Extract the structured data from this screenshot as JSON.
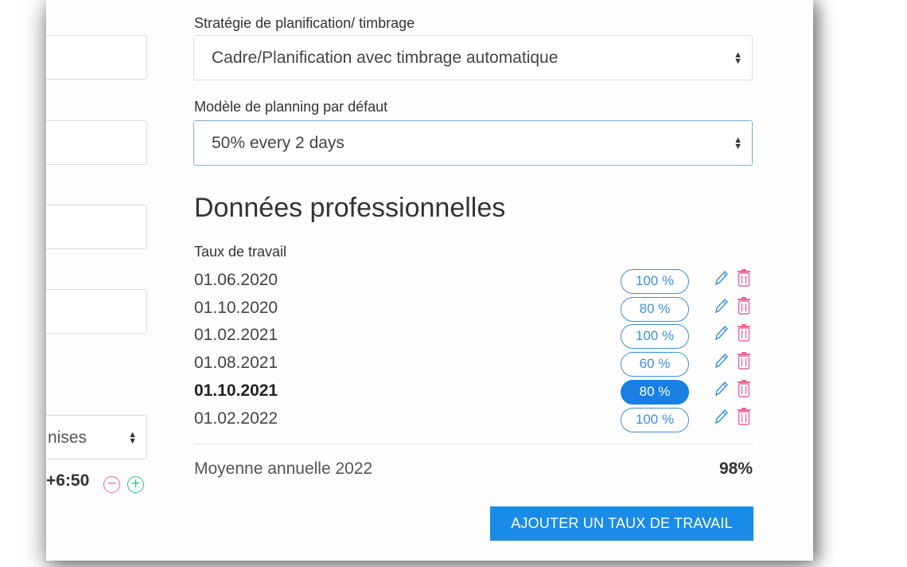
{
  "left_column": {
    "select_partial_value": "nises",
    "time_adjust": "+6:50"
  },
  "planning_strategy": {
    "label": "Stratégie de planification/ timbrage",
    "value": "Cadre/Planification avec timbrage automatique"
  },
  "default_planning_model": {
    "label": "Modèle de planning par défaut",
    "value": "50% every 2 days"
  },
  "professional_data": {
    "title": "Données professionnelles",
    "work_rate_label": "Taux de travail",
    "rates": [
      {
        "date": "01.06.2020",
        "rate": "100 %",
        "active": false
      },
      {
        "date": "01.10.2020",
        "rate": "80 %",
        "active": false
      },
      {
        "date": "01.02.2021",
        "rate": "100 %",
        "active": false
      },
      {
        "date": "01.08.2021",
        "rate": "60 %",
        "active": false
      },
      {
        "date": "01.10.2021",
        "rate": "80 %",
        "active": true
      },
      {
        "date": "01.02.2022",
        "rate": "100 %",
        "active": false
      }
    ],
    "annual_average_label": "Moyenne annuelle 2022",
    "annual_average_value": "98%",
    "add_button_label": "AJOUTER UN TAUX DE TRAVAIL"
  },
  "colors": {
    "accent": "#1a8ce8",
    "pill_border": "#3a8fe0",
    "delete": "#e8669a",
    "add": "#2fbf8a"
  },
  "icons": {
    "edit": "pencil-icon",
    "delete": "trash-icon",
    "minus": "minus-circle-icon",
    "plus": "plus-circle-icon",
    "select_arrows": "updown-arrows-icon"
  }
}
